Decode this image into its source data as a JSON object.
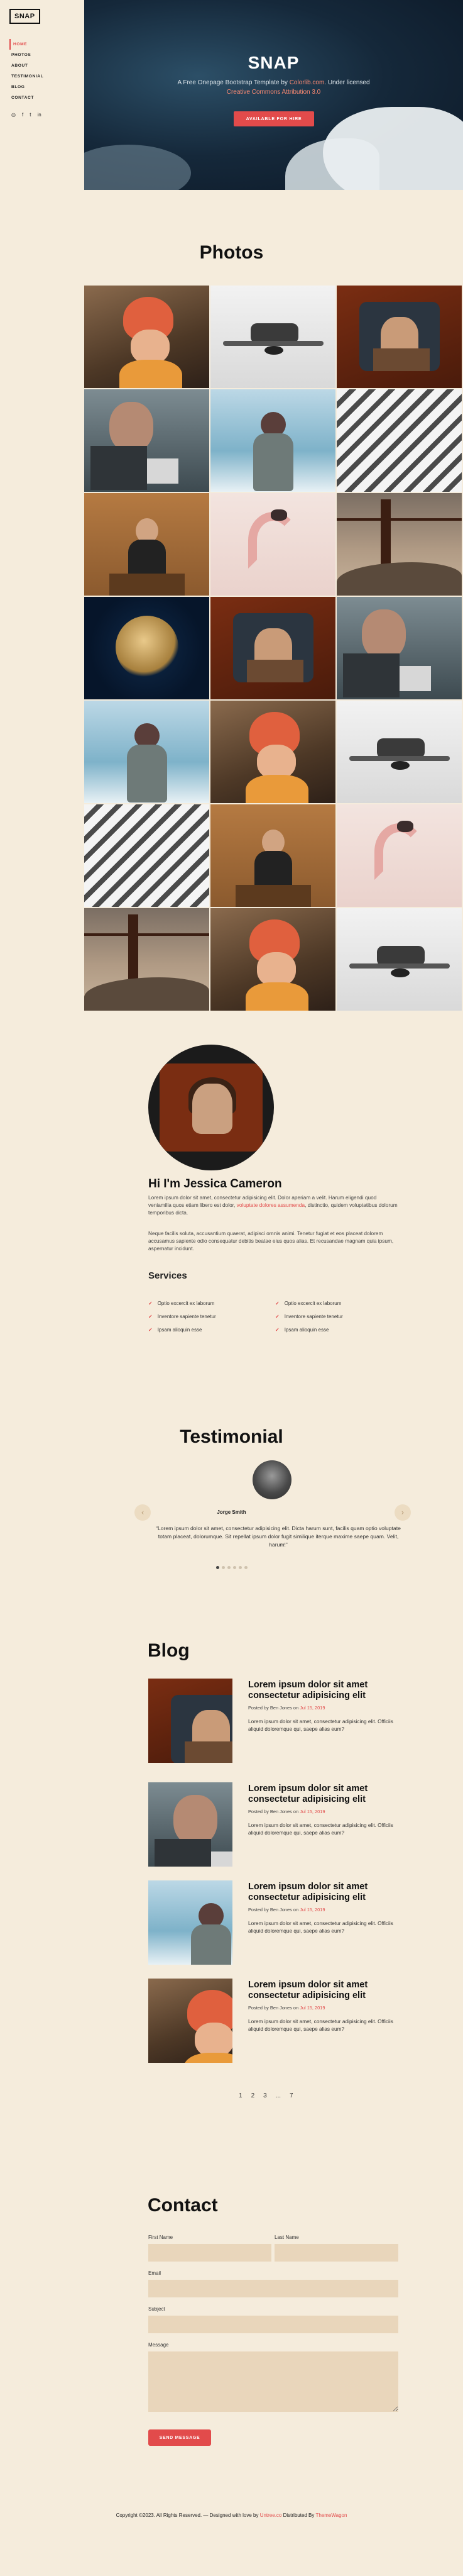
{
  "sidebar": {
    "logo": "SNAP",
    "nav": [
      "HOME",
      "PHOTOS",
      "ABOUT",
      "TESTIMONIAL",
      "BLOG",
      "CONTACT"
    ],
    "social": [
      "◎",
      "f",
      "t",
      "in"
    ]
  },
  "hero": {
    "title": "SNAP",
    "sub_a": "A Free Onepage Bootstrap Template by ",
    "sub_link1": "Colorlib.com",
    "sub_b": ". Under licensed",
    "sub_link2": "Creative Commons Attribution 3.0",
    "button": "AVAILABLE FOR HIRE"
  },
  "photos": {
    "title": "Photos",
    "tiles": [
      "woman",
      "drone",
      "window",
      "laptop",
      "snow",
      "building",
      "podium",
      "flamingo",
      "bridge",
      "jelly",
      "window",
      "laptop",
      "snow",
      "woman",
      "drone",
      "building",
      "podium",
      "flamingo",
      "bridge",
      "woman",
      "drone"
    ]
  },
  "about": {
    "name": "Hi I'm Jessica Cameron",
    "p1_a": "Lorem ipsum dolor sit amet, consectetur adipisicing elit. Dolor aperiam a velit. Harum eligendi quod veniamilla quos etiam libero est dolor, ",
    "p1_link": "voluptate dolores assumenda",
    "p1_b": ", distinctio, quidem voluptatibus dolorum temporibus dicta.",
    "p2": "Neque facilis soluta, accusantium quaerat, adipisci omnis animi. Tenetur fugiat et eos placeat dolorem accusamus sapiente odio consequatur debitis beatae eius quos alias. Et recusandae magnam quia ipsum, aspernatur incidunt.",
    "services_title": "Services",
    "services_left": [
      "Optio excercit ex laborum",
      "Inventore sapiente tenetur",
      "Ipsam alioquin esse"
    ],
    "services_right": [
      "Optio excercit ex laborum",
      "Inventore sapiente tenetur",
      "Ipsam alioquin esse"
    ]
  },
  "testimonial": {
    "title": "Testimonial",
    "name": "Jorge Smith",
    "quote": "“Lorem ipsum dolor sit amet, consectetur adipisicing elit. Dicta harum sunt, facilis quam optio voluptate totam placeat, dolorumque. Sit repellat ipsum dolor fugit similique iterque maxime saepe quam. Velit, harum!”",
    "prev": "‹",
    "next": "›",
    "dot_count": 6,
    "active_dot": 1
  },
  "blog": {
    "title": "Blog",
    "posts": [
      {
        "title": "Lorem ipsum dolor sit amet consectetur adipisicing elit",
        "meta_prefix": "Posted by Ben Jones on ",
        "date": "Jul 15, 2019",
        "excerpt": "Lorem ipsum dolor sit amet, consectetur adipisicing elit. Officiis aliquid doloremque qui, saepe alias eum?",
        "thumb": "window"
      },
      {
        "title": "Lorem ipsum dolor sit amet consectetur adipisicing elit",
        "meta_prefix": "Posted by Ben Jones on ",
        "date": "Jul 15, 2019",
        "excerpt": "Lorem ipsum dolor sit amet, consectetur adipisicing elit. Officiis aliquid doloremque qui, saepe alias eum?",
        "thumb": "laptop"
      },
      {
        "title": "Lorem ipsum dolor sit amet consectetur adipisicing elit",
        "meta_prefix": "Posted by Ben Jones on ",
        "date": "Jul 15, 2019",
        "excerpt": "Lorem ipsum dolor sit amet, consectetur adipisicing elit. Officiis aliquid doloremque qui, saepe alias eum?",
        "thumb": "snow"
      },
      {
        "title": "Lorem ipsum dolor sit amet consectetur adipisicing elit",
        "meta_prefix": "Posted by Ben Jones on ",
        "date": "Jul 15, 2019",
        "excerpt": "Lorem ipsum dolor sit amet, consectetur adipisicing elit. Officiis aliquid doloremque qui, saepe alias eum?",
        "thumb": "woman"
      }
    ],
    "pages": [
      "1",
      "2",
      "3",
      "...",
      "7"
    ]
  },
  "contact": {
    "title": "Contact",
    "first_name": "First Name",
    "last_name": "Last Name",
    "email": "Email",
    "subject": "Subject",
    "message": "Message",
    "button": "SEND MESSAGE"
  },
  "footer": {
    "text_a": "Copyright ©2023. All Rights Reserved. — Designed with love by ",
    "link1": "Untree.co",
    "text_b": " Distributed By ",
    "link2": "ThemeWagon"
  },
  "colors": {
    "accent": "#e24b4b",
    "background": "#f5ecdc",
    "field": "#e9d6bb"
  }
}
